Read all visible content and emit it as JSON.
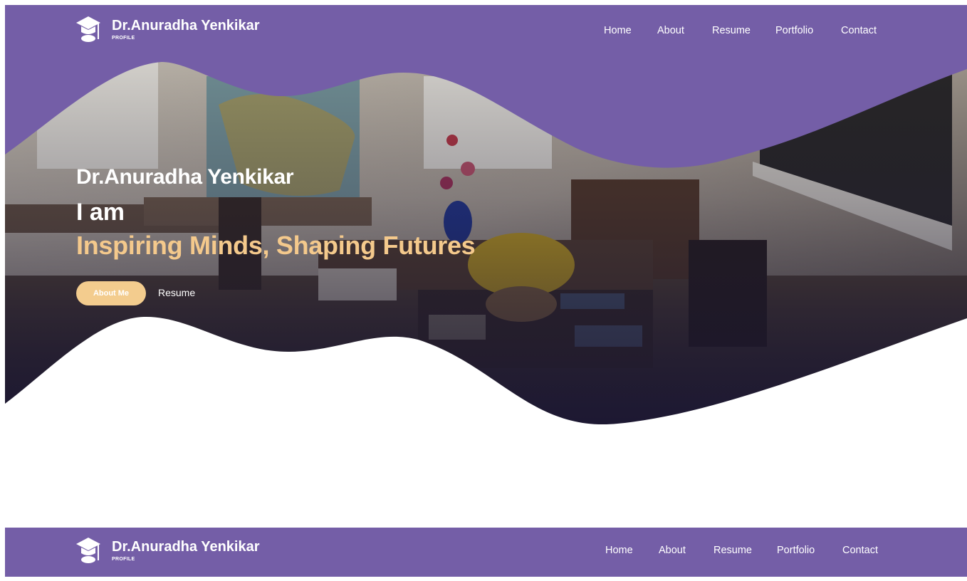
{
  "brand": {
    "name": "Dr.Anuradha Yenkikar",
    "subtitle": "PROFILE",
    "logo_icon": "graduation-cap-icon"
  },
  "nav": {
    "items": [
      {
        "label": "Home"
      },
      {
        "label": "About"
      },
      {
        "label": "Resume"
      },
      {
        "label": "Portfolio"
      },
      {
        "label": "Contact"
      }
    ]
  },
  "hero": {
    "name": "Dr.Anuradha Yenkikar",
    "intro": "I am",
    "tagline": "Inspiring Minds, Shaping Futures",
    "primary_button": "About Me",
    "secondary_link": "Resume"
  },
  "colors": {
    "brand_purple": "#745ea7",
    "accent_gold": "#f4c98c",
    "hero_overlay": "#1f1b3a"
  }
}
